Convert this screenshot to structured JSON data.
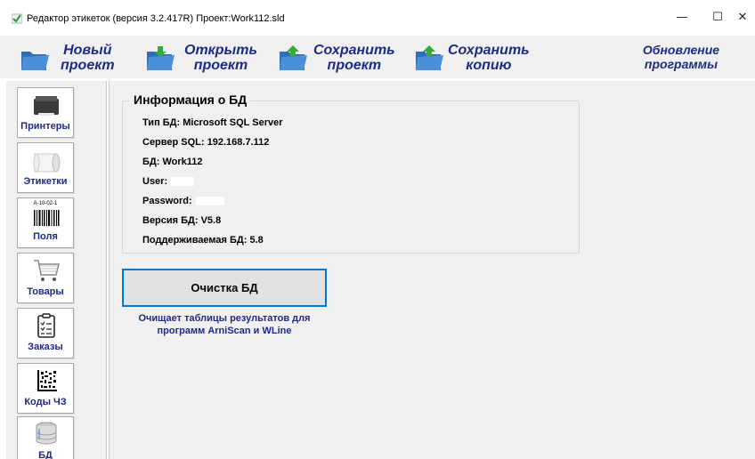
{
  "window": {
    "title": "Редактор этикеток (версия 3.2.417R) Проект:Work112.sld",
    "minimize": "—",
    "maximize": "☐",
    "close": "✕"
  },
  "toolbar": {
    "new_project": [
      "Новый",
      "проект"
    ],
    "open_project": [
      "Открыть",
      "проект"
    ],
    "save_project": [
      "Сохранить",
      "проект"
    ],
    "save_copy": [
      "Сохранить",
      "копию"
    ],
    "update_program": [
      "Обновление",
      "программы"
    ]
  },
  "sidebar": {
    "items": [
      {
        "label": "Принтеры",
        "icon": "printer-icon"
      },
      {
        "label": "Этикетки",
        "icon": "label-roll-icon"
      },
      {
        "label": "Поля",
        "icon": "barcode-icon",
        "barcode_text": "A-10-02-1"
      },
      {
        "label": "Товары",
        "icon": "cart-icon"
      },
      {
        "label": "Заказы",
        "icon": "clipboard-icon"
      },
      {
        "label": "Коды ЧЗ",
        "icon": "datamatrix-icon"
      },
      {
        "label": "БД",
        "icon": "database-icon"
      }
    ]
  },
  "db_info": {
    "title": "Информация о БД",
    "rows": [
      "Тип БД: Microsoft SQL Server",
      "Сервер SQL: 192.168.7.112",
      "БД: Work112",
      "User:",
      "Password:",
      "Версия БД: V5.8",
      "Поддерживаемая БД: 5.8"
    ]
  },
  "actions": {
    "clear_db_label": "Очистка БД",
    "clear_db_description": [
      "Очищает таблицы результатов для",
      "программ ArniScan и WLine"
    ]
  },
  "colors": {
    "accent_text": "#1e2a84",
    "button_focus_border": "#0078d7",
    "panel_bg": "#f0f0f0"
  }
}
